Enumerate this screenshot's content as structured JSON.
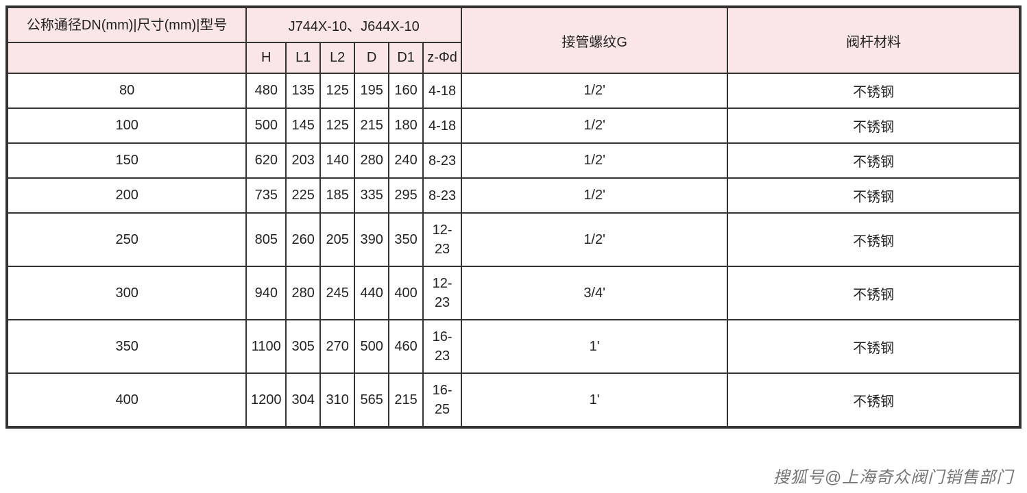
{
  "headers": {
    "dn": "公称通径DN(mm)|尺寸(mm)|型号",
    "model_group": "J744X-10、J644X-10",
    "sub": {
      "H": "H",
      "L1": "L1",
      "L2": "L2",
      "D": "D",
      "D1": "D1",
      "zPhi": "z-Φd"
    },
    "thread": "接管螺纹G",
    "material": "阀杆材料"
  },
  "watermark": "搜狐号@上海奇众阀门销售部门",
  "chart_data": {
    "type": "table",
    "columns": [
      "DN",
      "H",
      "L1",
      "L2",
      "D",
      "D1",
      "z-Φd",
      "接管螺纹G",
      "阀杆材料"
    ],
    "rows": [
      {
        "dn": "80",
        "H": "480",
        "L1": "135",
        "L2": "125",
        "D": "195",
        "D1": "160",
        "zPhi": "4-18",
        "thread": "1/2'",
        "material": "不锈钢"
      },
      {
        "dn": "100",
        "H": "500",
        "L1": "145",
        "L2": "125",
        "D": "215",
        "D1": "180",
        "zPhi": "4-18",
        "thread": "1/2'",
        "material": "不锈钢"
      },
      {
        "dn": "150",
        "H": "620",
        "L1": "203",
        "L2": "140",
        "D": "280",
        "D1": "240",
        "zPhi": "8-23",
        "thread": "1/2'",
        "material": "不锈钢"
      },
      {
        "dn": "200",
        "H": "735",
        "L1": "225",
        "L2": "185",
        "D": "335",
        "D1": "295",
        "zPhi": "8-23",
        "thread": "1/2'",
        "material": "不锈钢"
      },
      {
        "dn": "250",
        "H": "805",
        "L1": "260",
        "L2": "205",
        "D": "390",
        "D1": "350",
        "zPhi": "12-23",
        "thread": "1/2'",
        "material": "不锈钢"
      },
      {
        "dn": "300",
        "H": "940",
        "L1": "280",
        "L2": "245",
        "D": "440",
        "D1": "400",
        "zPhi": "12-23",
        "thread": "3/4'",
        "material": "不锈钢"
      },
      {
        "dn": "350",
        "H": "1100",
        "L1": "305",
        "L2": "270",
        "D": "500",
        "D1": "460",
        "zPhi": "16-23",
        "thread": "1'",
        "material": "不锈钢"
      },
      {
        "dn": "400",
        "H": "1200",
        "L1": "304",
        "L2": "310",
        "D": "565",
        "D1": "215",
        "zPhi": "16-25",
        "thread": "1'",
        "material": "不锈钢"
      }
    ]
  }
}
